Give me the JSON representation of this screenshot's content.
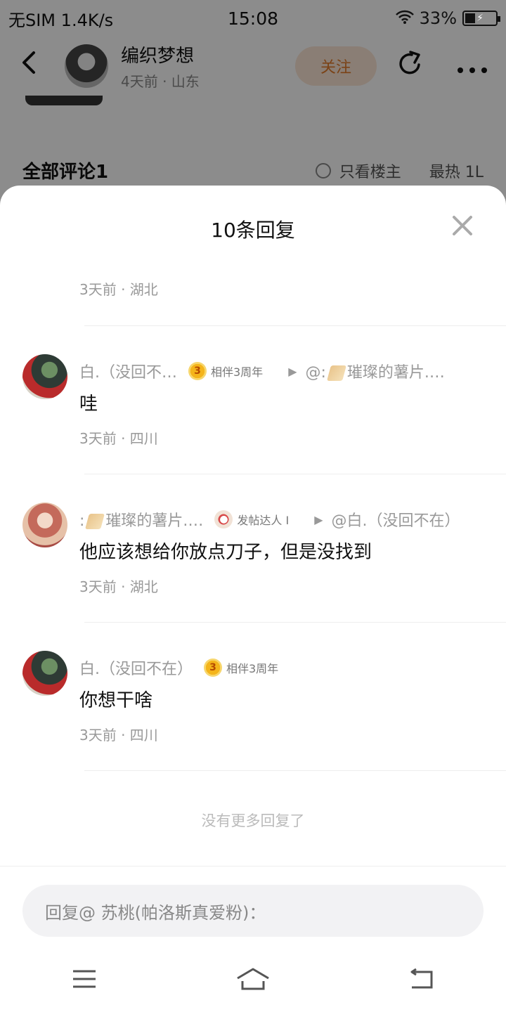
{
  "status_bar": {
    "carrier": "无SIM",
    "speed": "1.4K/s",
    "time": "15:08",
    "battery": "33%"
  },
  "post_header": {
    "author": "编织梦想",
    "meta": "4天前 · 山东",
    "follow_label": "关注",
    "share_icon": "share-icon",
    "more_icon": "more-icon"
  },
  "comments_section": {
    "title": "全部评论1",
    "only_owner": "只看楼主",
    "sort": "最热 1L"
  },
  "sheet": {
    "title": "10条回复",
    "close_icon": "close-icon",
    "first_meta": "3天前 · 湖北",
    "replies": [
      {
        "author": "白.（没回不…",
        "badge": "相伴3周年",
        "badge_num": "3",
        "reply_to": "@:",
        "reply_to_name": "璀璨的薯片.…",
        "content": "哇",
        "meta": "3天前 · 四川"
      },
      {
        "author_prefix": ":",
        "author": "璀璨的薯片.…",
        "badge": "发帖达人 I",
        "reply_to": "@白.（没回不在）",
        "content": "他应该想给你放点刀子，但是没找到",
        "meta": "3天前 · 湖北"
      },
      {
        "author": "白.（没回不在）",
        "badge": "相伴3周年",
        "badge_num": "3",
        "content": "你想干啥",
        "meta": "3天前 · 四川"
      }
    ],
    "no_more": "没有更多回复了",
    "input_placeholder": "回复@ 苏桃(帕洛斯真爱粉)："
  },
  "colors": {
    "accent_orange": "#e07b2a",
    "overlay": "rgba(0,0,0,0.45)"
  }
}
